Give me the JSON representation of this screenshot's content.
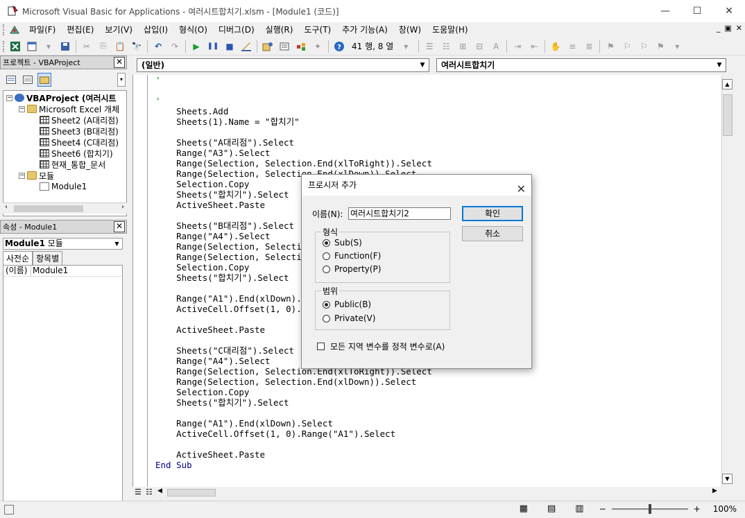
{
  "window": {
    "title": "Microsoft Visual Basic for Applications - 여러시트합치기.xlsm - [Module1 (코드)]",
    "minimize": "—",
    "maximize": "☐",
    "close": "✕"
  },
  "menu": {
    "items": [
      "파일(F)",
      "편집(E)",
      "보기(V)",
      "삽입(I)",
      "형식(O)",
      "디버그(D)",
      "실행(R)",
      "도구(T)",
      "추가 기능(A)",
      "창(W)",
      "도움말(H)"
    ],
    "mdi": [
      "_",
      "▣",
      "✕"
    ]
  },
  "toolbar": {
    "position": "41 행, 8 열",
    "icons": [
      "excel-icon",
      "insert-module-icon",
      "save-icon",
      "cut-icon",
      "copy-icon",
      "paste-icon",
      "find-icon",
      "undo-icon",
      "redo-icon",
      "run-icon",
      "break-icon",
      "reset-icon",
      "design-mode-icon",
      "project-explorer-icon",
      "properties-icon",
      "object-browser-icon",
      "toolbox-icon",
      "help-icon"
    ]
  },
  "project_pane": {
    "title": "프로젝트 - VBAProject",
    "close": "✕",
    "tree": [
      {
        "label": "VBAProject (여러시트",
        "level": 0,
        "type": "project",
        "exp": "−"
      },
      {
        "label": "Microsoft Excel 개체",
        "level": 1,
        "type": "folder",
        "exp": "−"
      },
      {
        "label": "Sheet2 (A대리점)",
        "level": 2,
        "type": "sheet"
      },
      {
        "label": "Sheet3 (B대리점)",
        "level": 2,
        "type": "sheet"
      },
      {
        "label": "Sheet4 (C대리점)",
        "level": 2,
        "type": "sheet"
      },
      {
        "label": "Sheet6 (합치기)",
        "level": 2,
        "type": "sheet"
      },
      {
        "label": "현재_통합_문서",
        "level": 2,
        "type": "workbook"
      },
      {
        "label": "모듈",
        "level": 1,
        "type": "folder",
        "exp": "−"
      },
      {
        "label": "Module1",
        "level": 2,
        "type": "module"
      }
    ]
  },
  "properties_pane": {
    "title": "속성 - Module1",
    "close": "✕",
    "object_name": "Module1",
    "object_type": "모듈",
    "tabs": [
      "사전순",
      "항목별"
    ],
    "rows": [
      {
        "key": "(이름)",
        "value": "Module1"
      }
    ]
  },
  "code_window": {
    "object_combo": "(일반)",
    "proc_combo": "여러시트합치기",
    "lines": [
      {
        "text": "'",
        "cls": "cm"
      },
      {
        "text": "",
        "cls": ""
      },
      {
        "text": "'",
        "cls": "cm"
      },
      {
        "text": "    Sheets.Add",
        "cls": ""
      },
      {
        "text": "    Sheets(1).Name = \"합치기\"",
        "cls": ""
      },
      {
        "text": "",
        "cls": ""
      },
      {
        "text": "    Sheets(\"A대리점\").Select",
        "cls": ""
      },
      {
        "text": "    Range(\"A3\").Select",
        "cls": ""
      },
      {
        "text": "    Range(Selection, Selection.End(xlToRight)).Select",
        "cls": ""
      },
      {
        "text": "    Range(Selection, Selection.End(xlDown)).Select",
        "cls": ""
      },
      {
        "text": "    Selection.Copy",
        "cls": ""
      },
      {
        "text": "    Sheets(\"합치기\").Select",
        "cls": ""
      },
      {
        "text": "    ActiveSheet.Paste",
        "cls": ""
      },
      {
        "text": "",
        "cls": ""
      },
      {
        "text": "    Sheets(\"B대리점\").Select",
        "cls": ""
      },
      {
        "text": "    Range(\"A4\").Select",
        "cls": ""
      },
      {
        "text": "    Range(Selection, Selection.End(xlToRight)).Select",
        "cls": ""
      },
      {
        "text": "    Range(Selection, Selection.End(xlDown)).Select",
        "cls": ""
      },
      {
        "text": "    Selection.Copy",
        "cls": ""
      },
      {
        "text": "    Sheets(\"합치기\").Select",
        "cls": ""
      },
      {
        "text": "",
        "cls": ""
      },
      {
        "text": "    Range(\"A1\").End(xlDown).Select",
        "cls": ""
      },
      {
        "text": "    ActiveCell.Offset(1, 0).Range(\"A1\").Select",
        "cls": ""
      },
      {
        "text": "",
        "cls": ""
      },
      {
        "text": "    ActiveSheet.Paste",
        "cls": ""
      },
      {
        "text": "",
        "cls": ""
      },
      {
        "text": "    Sheets(\"C대리점\").Select",
        "cls": ""
      },
      {
        "text": "    Range(\"A4\").Select",
        "cls": ""
      },
      {
        "text": "    Range(Selection, Selection.End(xlToRight)).Select",
        "cls": ""
      },
      {
        "text": "    Range(Selection, Selection.End(xlDown)).Select",
        "cls": ""
      },
      {
        "text": "    Selection.Copy",
        "cls": ""
      },
      {
        "text": "    Sheets(\"합치기\").Select",
        "cls": ""
      },
      {
        "text": "",
        "cls": ""
      },
      {
        "text": "    Range(\"A1\").End(xlDown).Select",
        "cls": ""
      },
      {
        "text": "    ActiveCell.Offset(1, 0).Range(\"A1\").Select",
        "cls": ""
      },
      {
        "text": "",
        "cls": ""
      },
      {
        "text": "    ActiveSheet.Paste",
        "cls": ""
      },
      {
        "text": "End Sub",
        "cls": "kw"
      }
    ]
  },
  "dialog": {
    "title": "프로시저 추가",
    "close": "✕",
    "name_label": "이름(N):",
    "name_value": "여러시트합치기2",
    "ok": "확인",
    "cancel": "취소",
    "type_group": "형식",
    "type_options": [
      {
        "label": "Sub(S)",
        "checked": true
      },
      {
        "label": "Function(F)",
        "checked": false
      },
      {
        "label": "Property(P)",
        "checked": false
      }
    ],
    "scope_group": "범위",
    "scope_options": [
      {
        "label": "Public(B)",
        "checked": true
      },
      {
        "label": "Private(V)",
        "checked": false
      }
    ],
    "static_label": "모든 지역 변수를 정적 변수로(A)",
    "static_checked": false
  },
  "statusbar": {
    "zoom_minus": "−",
    "zoom_plus": "+",
    "zoom": "100%",
    "zoom_fraction": 0.5
  }
}
